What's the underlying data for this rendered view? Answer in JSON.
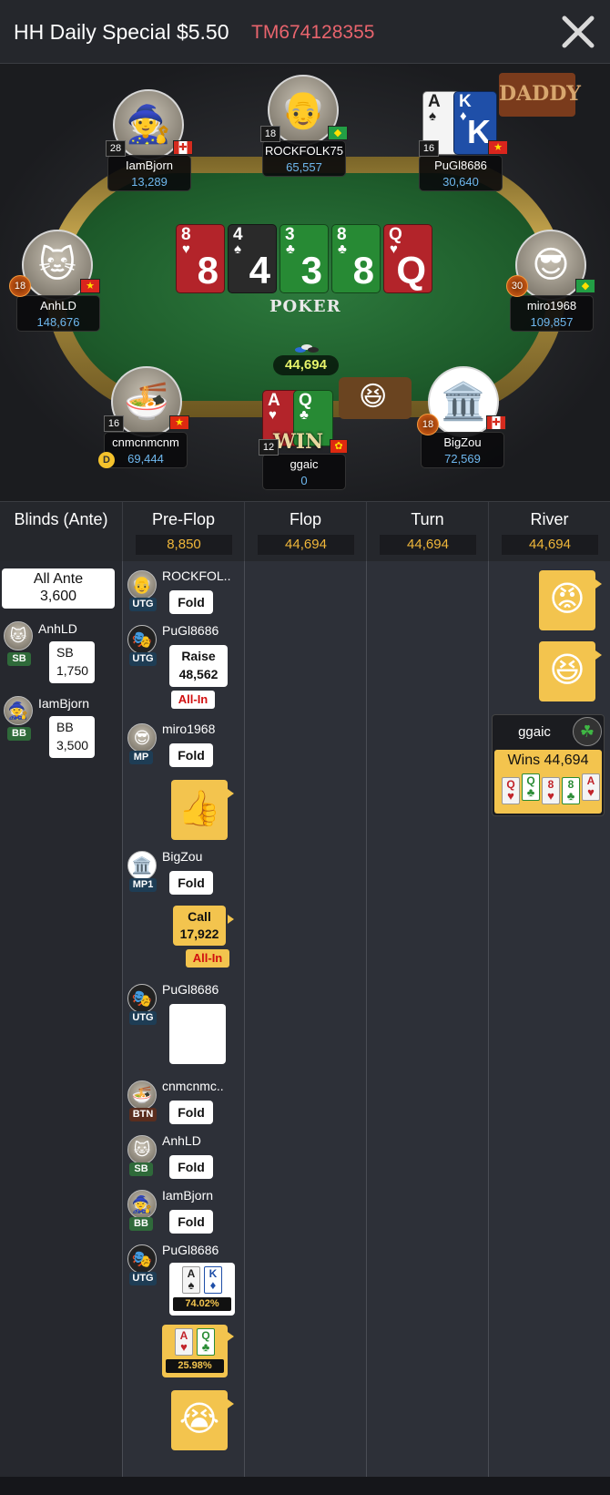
{
  "header": {
    "title": "HH Daily Special $5.50",
    "hand_id": "TM674128355"
  },
  "table": {
    "board": [
      {
        "rank": "8",
        "suit": "♥",
        "color": "red"
      },
      {
        "rank": "4",
        "suit": "♠",
        "color": "black"
      },
      {
        "rank": "3",
        "suit": "♣",
        "color": "green"
      },
      {
        "rank": "8",
        "suit": "♣",
        "color": "green"
      },
      {
        "rank": "Q",
        "suit": "♥",
        "color": "red"
      }
    ],
    "logo": "POKER",
    "pot": "44,694",
    "win_label": "WIN",
    "dealer_label": "D",
    "banner": "DADDY",
    "seats": [
      {
        "name": "IamBjorn",
        "chips": "13,289",
        "level": "28",
        "flag": "ca"
      },
      {
        "name": "ROCKFOLK75",
        "chips": "65,557",
        "level": "18",
        "flag": "br"
      },
      {
        "name": "PuGl8686",
        "chips": "30,640",
        "level": "16",
        "flag": "vn"
      },
      {
        "name": "AnhLD",
        "chips": "148,676",
        "level": "18",
        "flag": "vn"
      },
      {
        "name": "miro1968",
        "chips": "109,857",
        "level": "30",
        "flag": "br"
      },
      {
        "name": "cnmcnmcnm",
        "chips": "69,444",
        "level": "16",
        "flag": "cn"
      },
      {
        "name": "ggaic",
        "chips": "0",
        "level": "12",
        "flag": "hk"
      },
      {
        "name": "BigZou",
        "chips": "72,569",
        "level": "18",
        "flag": "ca"
      }
    ],
    "hole_cards_pugl": [
      {
        "rank": "A",
        "suit": "♠",
        "color": "white"
      },
      {
        "rank": "K",
        "suit": "♦",
        "color": "blue"
      }
    ],
    "hole_cards_ggaic": [
      {
        "rank": "A",
        "suit": "♥",
        "color": "red"
      },
      {
        "rank": "Q",
        "suit": "♣",
        "color": "green"
      }
    ]
  },
  "streets": [
    {
      "label": "Blinds (Ante)",
      "pot": ""
    },
    {
      "label": "Pre-Flop",
      "pot": "8,850"
    },
    {
      "label": "Flop",
      "pot": "44,694"
    },
    {
      "label": "Turn",
      "pot": "44,694"
    },
    {
      "label": "River",
      "pot": "44,694"
    }
  ],
  "blinds": {
    "ante_label": "All Ante",
    "ante_value": "3,600",
    "sb": {
      "name": "AnhLD",
      "pos": "SB",
      "label": "SB",
      "amount": "1,750"
    },
    "bb": {
      "name": "IamBjorn",
      "pos": "BB",
      "label": "BB",
      "amount": "3,500"
    }
  },
  "preflop": [
    {
      "name": "ROCKFOL..",
      "pos": "UTG",
      "action": "Fold"
    },
    {
      "name": "PuGl8686",
      "pos": "UTG",
      "action": "Raise",
      "amount": "48,562",
      "allin": "All-In"
    },
    {
      "name": "miro1968",
      "pos": "MP",
      "action": "Fold"
    },
    {
      "name": "BigZou",
      "pos": "MP1",
      "action": "Fold"
    },
    {
      "action": "Call",
      "amount": "17,922",
      "allin": "All-In"
    },
    {
      "name": "PuGl8686",
      "pos": "UTG"
    },
    {
      "name": "cnmcnmc..",
      "pos": "BTN",
      "action": "Fold"
    },
    {
      "name": "AnhLD",
      "pos": "SB",
      "action": "Fold"
    },
    {
      "name": "IamBjorn",
      "pos": "BB",
      "action": "Fold"
    },
    {
      "name": "PuGl8686",
      "pos": "UTG",
      "equity": "74.02%"
    },
    {
      "equity": "25.98%"
    }
  ],
  "river": {
    "winner": "ggaic",
    "wins_text": "Wins 44,694",
    "best_hand": [
      {
        "rank": "Q",
        "suit": "♥"
      },
      {
        "rank": "Q",
        "suit": "♣"
      },
      {
        "rank": "8",
        "suit": "♥"
      },
      {
        "rank": "8",
        "suit": "♣"
      },
      {
        "rank": "A",
        "suit": "♥"
      }
    ]
  },
  "colors": {
    "accent_gold": "#f3c44e",
    "hand_id_red": "#e8646d",
    "chip_blue": "#6fb8ef",
    "allin_red": "#d10f0f"
  }
}
